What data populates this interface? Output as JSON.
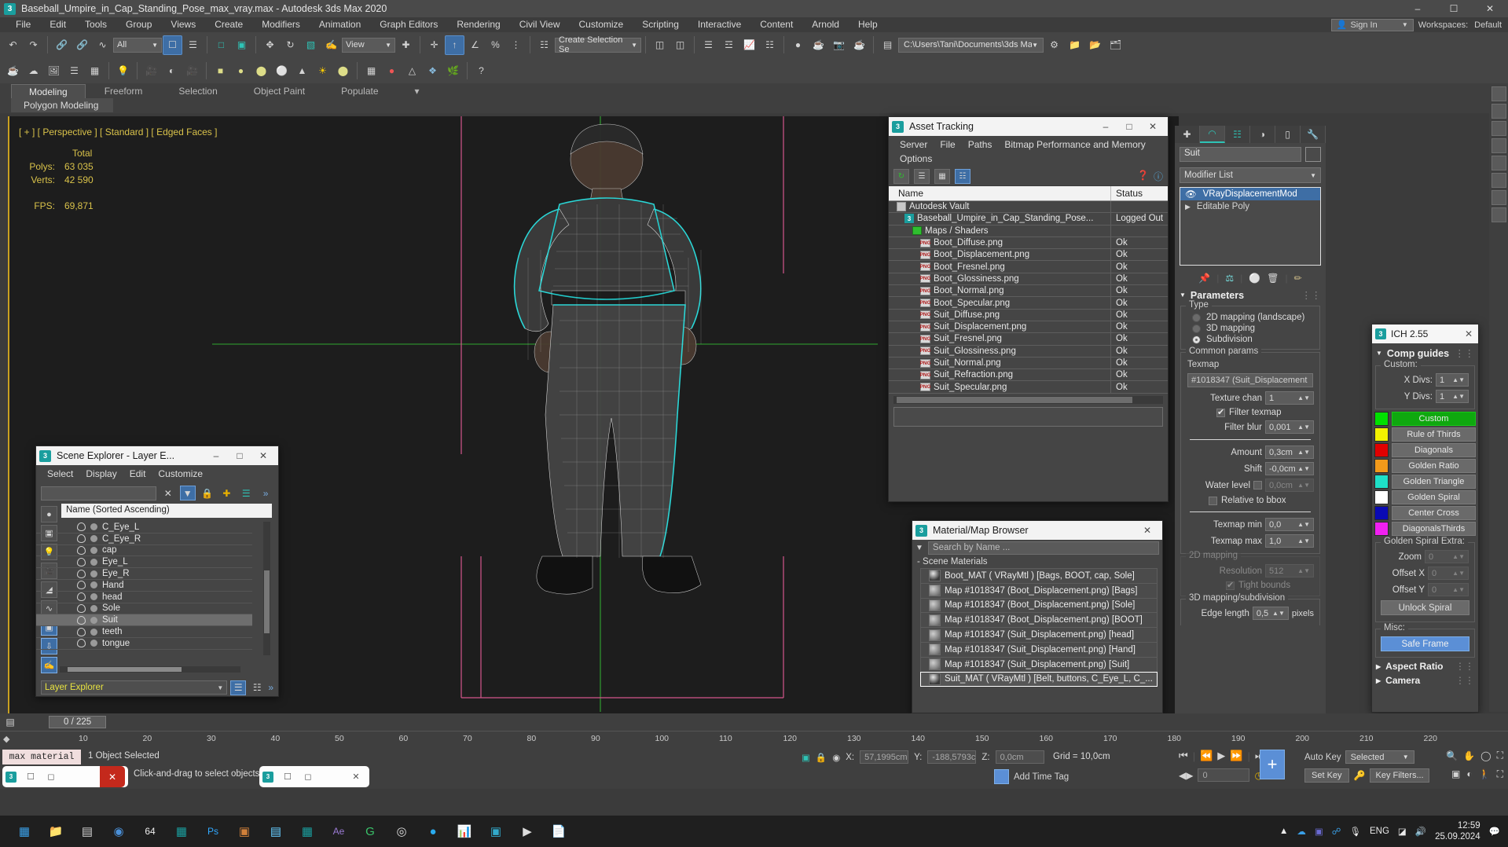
{
  "window": {
    "title": "Baseball_Umpire_in_Cap_Standing_Pose_max_vray.max - Autodesk 3ds Max 2020",
    "minimize": "–",
    "maximize": "☐",
    "close": "✕"
  },
  "menu": {
    "items": [
      "File",
      "Edit",
      "Tools",
      "Group",
      "Views",
      "Create",
      "Modifiers",
      "Animation",
      "Graph Editors",
      "Rendering",
      "Civil View",
      "Customize",
      "Scripting",
      "Interactive",
      "Content",
      "Arnold",
      "Help"
    ],
    "signin": "Sign In",
    "workspaces_label": "Workspaces:",
    "workspaces_value": "Default"
  },
  "toolbar": {
    "selection_filter": "All",
    "ref_coord": "View",
    "named_selection": "Create Selection Se",
    "project_path": "C:\\Users\\Tani\\Documents\\3ds Max 2020"
  },
  "ribbon": {
    "tabs": [
      "Modeling",
      "Freeform",
      "Selection",
      "Object Paint",
      "Populate"
    ],
    "active_tab": "Modeling",
    "subtitle": "Polygon Modeling"
  },
  "viewport": {
    "label": "[ + ] [ Perspective ] [ Standard ] [ Edged Faces ]",
    "stats_header": "Total",
    "polys_label": "Polys:",
    "polys_value": "63 035",
    "verts_label": "Verts:",
    "verts_value": "42 590",
    "fps_label": "FPS:",
    "fps_value": "69,871"
  },
  "asset_tracking": {
    "title": "Asset Tracking",
    "menu": [
      "Server",
      "File",
      "Paths",
      "Bitmap Performance and Memory",
      "Options"
    ],
    "col_name": "Name",
    "col_status": "Status",
    "rows": [
      {
        "name": "Autodesk Vault",
        "status": "",
        "icon": "vault",
        "indent": 1
      },
      {
        "name": "Baseball_Umpire_in_Cap_Standing_Pose...",
        "status": "Logged Out",
        "icon": "max",
        "indent": 2
      },
      {
        "name": "Maps / Shaders",
        "status": "",
        "icon": "maps",
        "indent": 3
      },
      {
        "name": "Boot_Diffuse.png",
        "status": "Ok",
        "icon": "png",
        "indent": 4
      },
      {
        "name": "Boot_Displacement.png",
        "status": "Ok",
        "icon": "png",
        "indent": 4
      },
      {
        "name": "Boot_Fresnel.png",
        "status": "Ok",
        "icon": "png",
        "indent": 4
      },
      {
        "name": "Boot_Glossiness.png",
        "status": "Ok",
        "icon": "png",
        "indent": 4
      },
      {
        "name": "Boot_Normal.png",
        "status": "Ok",
        "icon": "png",
        "indent": 4
      },
      {
        "name": "Boot_Specular.png",
        "status": "Ok",
        "icon": "png",
        "indent": 4
      },
      {
        "name": "Suit_Diffuse.png",
        "status": "Ok",
        "icon": "png",
        "indent": 4
      },
      {
        "name": "Suit_Displacement.png",
        "status": "Ok",
        "icon": "png",
        "indent": 4
      },
      {
        "name": "Suit_Fresnel.png",
        "status": "Ok",
        "icon": "png",
        "indent": 4
      },
      {
        "name": "Suit_Glossiness.png",
        "status": "Ok",
        "icon": "png",
        "indent": 4
      },
      {
        "name": "Suit_Normal.png",
        "status": "Ok",
        "icon": "png",
        "indent": 4
      },
      {
        "name": "Suit_Refraction.png",
        "status": "Ok",
        "icon": "png",
        "indent": 4
      },
      {
        "name": "Suit_Specular.png",
        "status": "Ok",
        "icon": "png",
        "indent": 4
      }
    ]
  },
  "material_browser": {
    "title": "Material/Map Browser",
    "search_placeholder": "Search by Name ...",
    "section": "Scene Materials",
    "rows": [
      {
        "label": "Boot_MAT  ( VRayMtl )  [Bags, BOOT, cap, Sole]",
        "type": "mat",
        "selected": false
      },
      {
        "label": "Map #1018347 (Boot_Displacement.png) [Bags]",
        "type": "map",
        "selected": false
      },
      {
        "label": "Map #1018347 (Boot_Displacement.png) [Sole]",
        "type": "map",
        "selected": false
      },
      {
        "label": "Map #1018347 (Boot_Displacement.png) [BOOT]",
        "type": "map",
        "selected": false
      },
      {
        "label": "Map #1018347 (Suit_Displacement.png) [head]",
        "type": "map",
        "selected": false
      },
      {
        "label": "Map #1018347 (Suit_Displacement.png) [Hand]",
        "type": "map",
        "selected": false
      },
      {
        "label": "Map #1018347 (Suit_Displacement.png) [Suit]",
        "type": "map",
        "selected": false
      },
      {
        "label": "Suit_MAT  ( VRayMtl )  [Belt, buttons, C_Eye_L, C_...",
        "type": "mat",
        "selected": true
      }
    ]
  },
  "scene_explorer": {
    "title": "Scene Explorer - Layer E...",
    "menu": [
      "Select",
      "Display",
      "Edit",
      "Customize"
    ],
    "filter_value": "",
    "column_header": "Name (Sorted Ascending)",
    "objects": [
      {
        "name": "C_Eye_L",
        "selected": false
      },
      {
        "name": "C_Eye_R",
        "selected": false
      },
      {
        "name": "cap",
        "selected": false
      },
      {
        "name": "Eye_L",
        "selected": false
      },
      {
        "name": "Eye_R",
        "selected": false
      },
      {
        "name": "Hand",
        "selected": false
      },
      {
        "name": "head",
        "selected": false
      },
      {
        "name": "Sole",
        "selected": false
      },
      {
        "name": "Suit",
        "selected": true
      },
      {
        "name": "teeth",
        "selected": false
      },
      {
        "name": "tongue",
        "selected": false
      }
    ],
    "footer_combo": "Layer Explorer"
  },
  "command_panel": {
    "object_name": "Suit",
    "modifier_list_label": "Modifier List",
    "modifiers": [
      {
        "name": "VRayDisplacementMod",
        "selected": true
      },
      {
        "name": "Editable Poly",
        "selected": false
      }
    ],
    "rollout_parameters": "Parameters",
    "type_group": "Type",
    "type_options": [
      {
        "label": "2D mapping (landscape)",
        "checked": false
      },
      {
        "label": "3D mapping",
        "checked": false
      },
      {
        "label": "Subdivision",
        "checked": true
      }
    ],
    "common_group": "Common params",
    "texmap_label": "Texmap",
    "texmap_value": "#1018347 (Suit_Displacement",
    "texture_chan_label": "Texture chan",
    "texture_chan_value": "1",
    "filter_texmap_label": "Filter texmap",
    "filter_texmap_checked": true,
    "filter_blur_label": "Filter blur",
    "filter_blur_value": "0,001",
    "amount_label": "Amount",
    "amount_value": "0,3cm",
    "shift_label": "Shift",
    "shift_value": "-0,0cm",
    "water_level_label": "Water level",
    "water_level_value": "0,0cm",
    "relative_bbox_label": "Relative to bbox",
    "texmap_min_label": "Texmap min",
    "texmap_min_value": "0,0",
    "texmap_max_label": "Texmap max",
    "texmap_max_value": "1,0",
    "mapping2d_group": "2D mapping",
    "resolution_label": "Resolution",
    "resolution_value": "512",
    "tight_bounds_label": "Tight bounds",
    "mapping3d_group": "3D mapping/subdivision",
    "edge_length_label": "Edge length",
    "edge_length_value": "0,5",
    "edge_length_unit": "pixels"
  },
  "ich_panel": {
    "title": "ICH 2.55",
    "rollout": "Comp guides",
    "custom_label": "Custom:",
    "x_divs_label": "X Divs:",
    "x_divs_value": "1",
    "y_divs_label": "Y Divs:",
    "y_divs_value": "1",
    "guides": [
      {
        "label": "Custom",
        "color": "#00e000",
        "active": true
      },
      {
        "label": "Rule of Thirds",
        "color": "#f2f200",
        "active": false
      },
      {
        "label": "Diagonals",
        "color": "#e00000",
        "active": false
      },
      {
        "label": "Golden Ratio",
        "color": "#f29a1a",
        "active": false
      },
      {
        "label": "Golden Triangle",
        "color": "#1ee0c8",
        "active": false
      },
      {
        "label": "Golden Spiral",
        "color": "#ffffff",
        "active": false
      },
      {
        "label": "Center Cross",
        "color": "#0a0ab4",
        "active": false
      },
      {
        "label": "DiagonalsThirds",
        "color": "#f020f0",
        "active": false
      }
    ],
    "spiral_group": "Golden Spiral Extra:",
    "zoom_label": "Zoom",
    "zoom_value": "0",
    "offset_x_label": "Offset X",
    "offset_x_value": "0",
    "offset_y_label": "Offset Y",
    "offset_y_value": "0",
    "unlock_spiral": "Unlock Spiral",
    "misc_group": "Misc:",
    "safe_frame": "Safe Frame",
    "aspect_ratio": "Aspect Ratio",
    "camera": "Camera"
  },
  "timeline": {
    "frame_current": "0 / 225",
    "ticks": [
      "10",
      "20",
      "30",
      "40",
      "50",
      "60",
      "70",
      "80",
      "90",
      "100",
      "110",
      "120",
      "130",
      "140",
      "150",
      "160",
      "170",
      "180",
      "190",
      "200",
      "210",
      "220"
    ]
  },
  "status": {
    "max_material": "max material",
    "selection_info": "1 Object Selected",
    "prompt": "Click-and-drag to select objects",
    "x_label": "X:",
    "x_value": "57,1995cm",
    "y_label": "Y:",
    "y_value": "-188,5793c",
    "z_label": "Z:",
    "z_value": "0,0cm",
    "grid": "Grid = 10,0cm",
    "add_time_tag": "Add Time Tag",
    "auto_key": "Auto Key",
    "set_key": "Set Key",
    "selected_combo": "Selected",
    "key_filters": "Key Filters...",
    "frame_field": "0"
  },
  "taskbar": {
    "time": "12:59",
    "date": "25.09.2024",
    "language": "ENG"
  }
}
